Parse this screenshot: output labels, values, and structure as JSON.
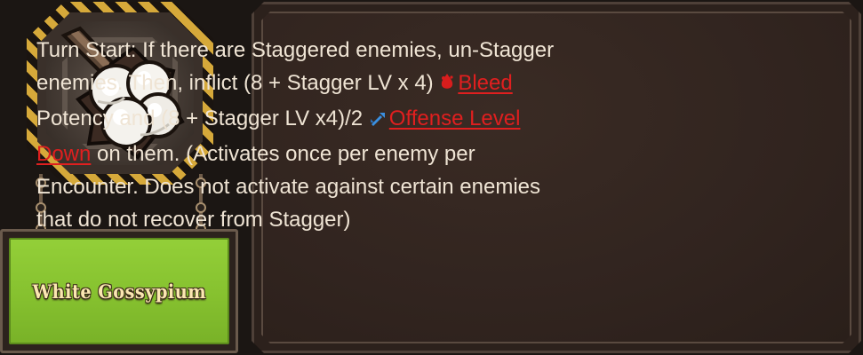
{
  "passive": {
    "name": "White Gossypium",
    "icon": "cotton-boll-icon",
    "accent_color": "#86c12f",
    "description": {
      "part1": "Turn Start: If there are Staggered enemies, un-Stagger enemies. Then, inflict (8 + Stagger LV x 4)",
      "keyword1": "Bleed",
      "keyword1_icon": "bleed-icon",
      "part2": "Potency and (8 + Stagger LV x4)/2",
      "keyword2": "Offense Level Down",
      "keyword2_icon": "offense-level-down-icon",
      "part3": "on them. (Activates once per enemy per Encounter. Does not activate against certain enemies that do not recover from Stagger)"
    },
    "keyword_color": "#e01f1f"
  }
}
